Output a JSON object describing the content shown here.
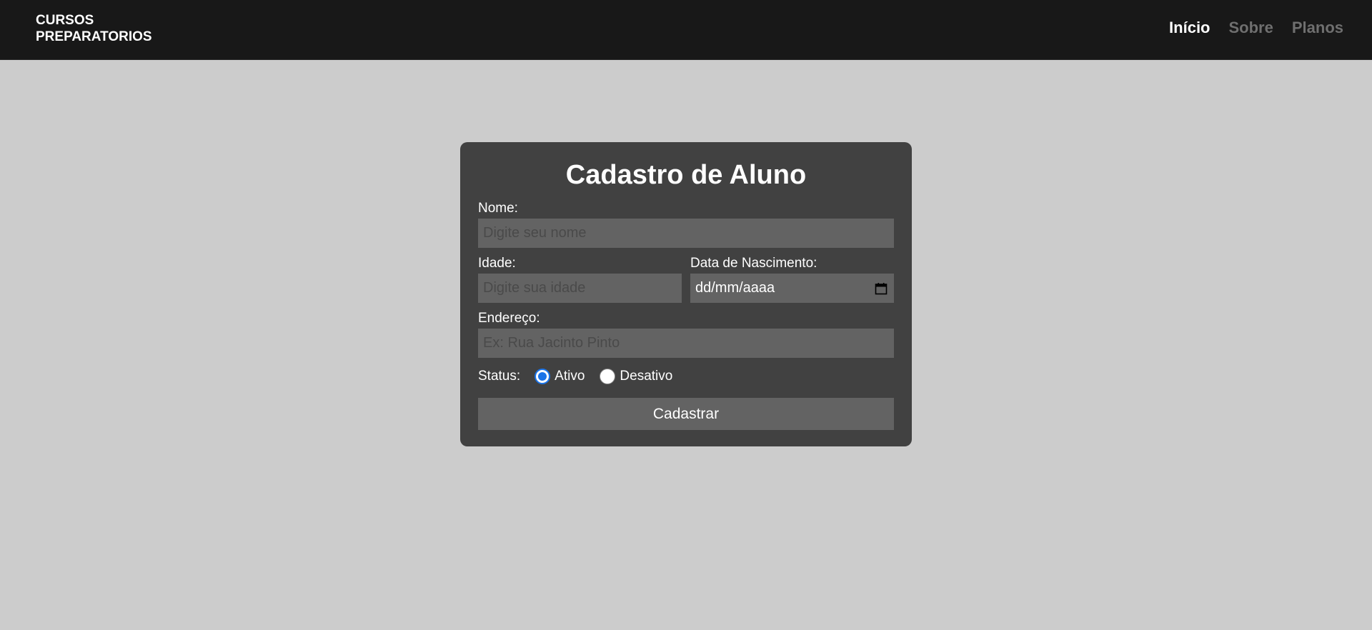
{
  "header": {
    "brand_line1": "CURSOS",
    "brand_line2": "PREPARATORIOS",
    "nav": [
      {
        "label": "Início",
        "active": true
      },
      {
        "label": "Sobre",
        "active": false
      },
      {
        "label": "Planos",
        "active": false
      }
    ]
  },
  "form": {
    "title": "Cadastro de Aluno",
    "nome": {
      "label": "Nome:",
      "placeholder": "Digite seu nome",
      "value": ""
    },
    "idade": {
      "label": "Idade:",
      "placeholder": "Digite sua idade",
      "value": ""
    },
    "nascimento": {
      "label": "Data de Nascimento:",
      "value": "dd/mm/aaaa",
      "icon": "calendar-icon"
    },
    "endereco": {
      "label": "Endereço:",
      "placeholder": "Ex: Rua Jacinto Pinto",
      "value": ""
    },
    "status": {
      "label": "Status:",
      "options": [
        {
          "label": "Ativo",
          "checked": true
        },
        {
          "label": "Desativo",
          "checked": false
        }
      ]
    },
    "submit_label": "Cadastrar"
  },
  "colors": {
    "topbar": "#181818",
    "page_bg": "#cccccc",
    "card_bg": "#414141",
    "field_bg": "#636363",
    "radio_accent": "#1a73e8"
  }
}
